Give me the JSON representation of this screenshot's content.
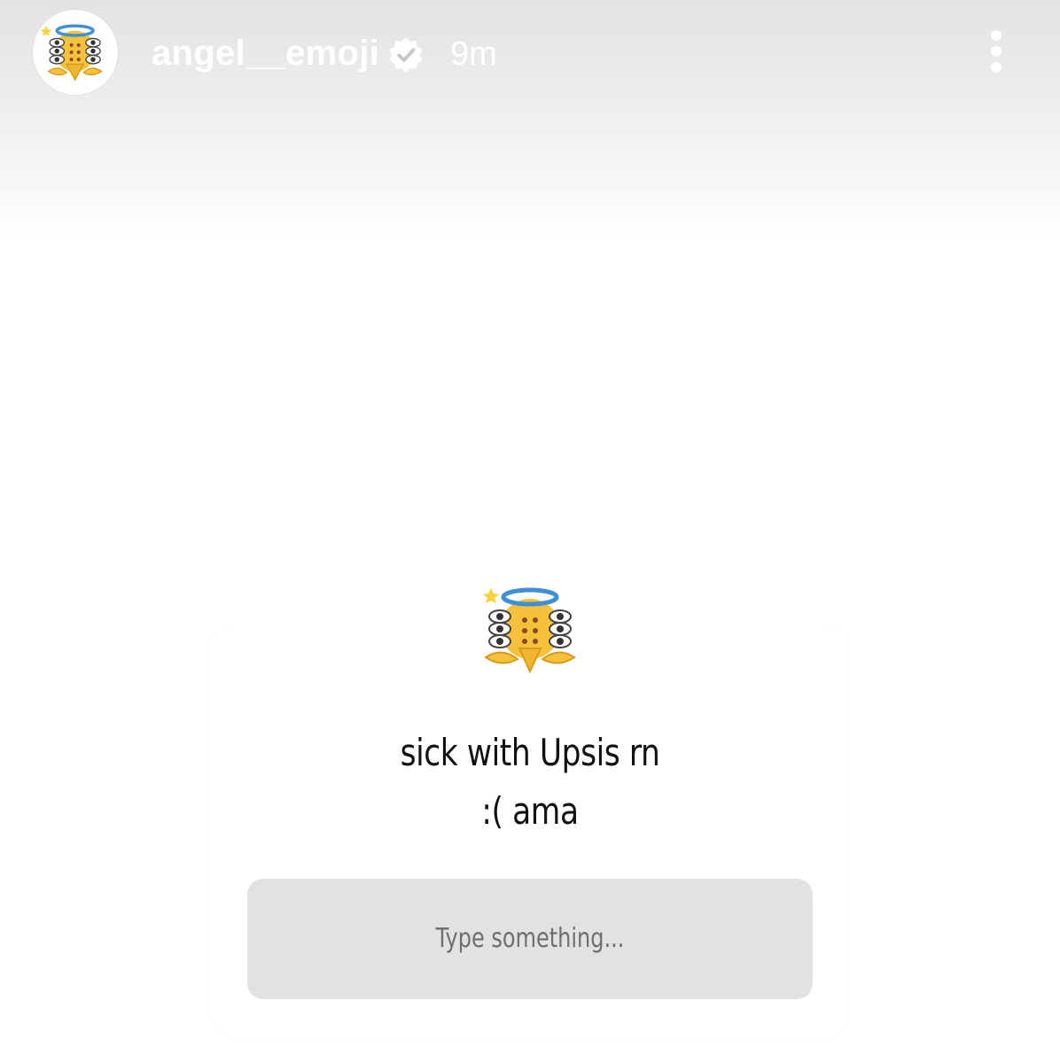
{
  "header": {
    "username": "angel__emoji",
    "time_ago": "9m",
    "avatar_icon": "angel-emoji-avatar-icon",
    "verified_icon": "verified-badge-icon",
    "more_icon": "more-options-icon"
  },
  "question_sticker": {
    "emoji_icon": "angel-emoji-icon",
    "prompt_line1": "sick with Upsis rn",
    "prompt_line2": ":( ama",
    "answer_placeholder": "Type something..."
  },
  "colors": {
    "header_text": "#ffffff",
    "answer_box_bg": "#e2e2e2",
    "halo_blue": "#3d8fd6",
    "emoji_yellow": "#f6c13b"
  }
}
